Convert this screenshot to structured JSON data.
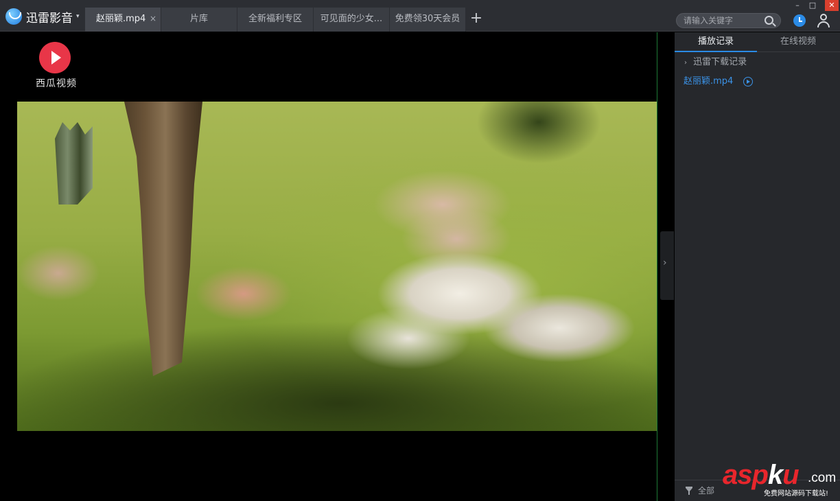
{
  "app": {
    "name": "迅雷影音",
    "caret": "▾"
  },
  "tabs": [
    {
      "label": "赵丽颖.mp4",
      "close": "×"
    },
    {
      "label": "片库"
    },
    {
      "label": "全新福利专区"
    },
    {
      "label": "可见面的少女..."
    },
    {
      "label": "免费领30天会员"
    }
  ],
  "add_tab": "+",
  "search": {
    "placeholder": "请输入关键字"
  },
  "window_controls": {
    "minimize": "–",
    "maximize": "□",
    "close": "✕"
  },
  "video": {
    "overlay_logo_text": "西瓜视频"
  },
  "collapse_arrow": "›",
  "sidebar": {
    "tabs": [
      "播放记录",
      "在线视频"
    ],
    "folder": {
      "chevron": "›",
      "label": "迅雷下载记录"
    },
    "items": [
      {
        "label": "赵丽颖.mp4"
      }
    ],
    "filter_label": "全部"
  },
  "watermark": {
    "brand_a": "asp",
    "brand_b": "k",
    "brand_c": "u",
    "domain": ".com",
    "tagline": "免费网站源码下载站!"
  },
  "colors": {
    "accent": "#2b8be6",
    "close_button": "#d9402e",
    "xigua_red": "#e83648"
  }
}
